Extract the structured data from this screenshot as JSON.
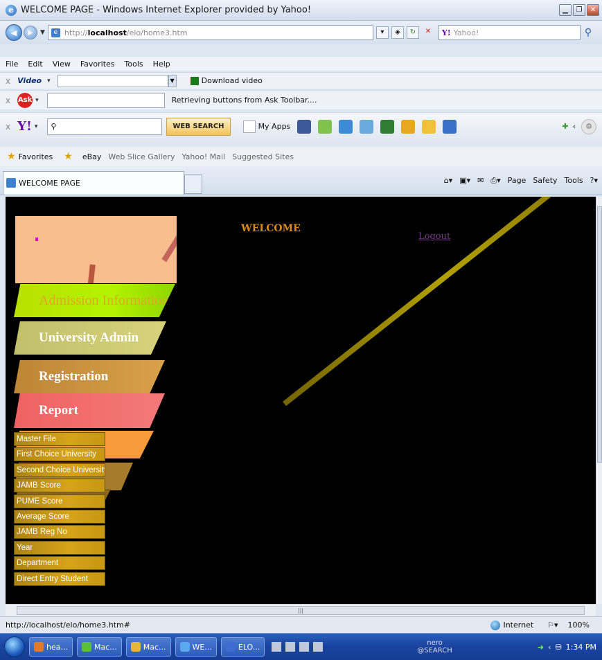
{
  "window": {
    "title": "WELCOME PAGE - Windows Internet Explorer provided by Yahoo!"
  },
  "address": {
    "url_prefix": "http://",
    "url_host": "localhost",
    "url_path": "/elo/home3.htm",
    "search_placeholder": "Yahoo!"
  },
  "menu": [
    "File",
    "Edit",
    "View",
    "Favorites",
    "Tools",
    "Help"
  ],
  "video_toolbar": {
    "label": "Video",
    "download": "Download video"
  },
  "ask_toolbar": {
    "status": "Retrieving buttons from Ask Toolbar...."
  },
  "yahoo_toolbar": {
    "search_button": "WEB SEARCH",
    "my_apps": "My Apps"
  },
  "favorites_bar": {
    "favorites": "Favorites",
    "items": [
      "eBay",
      "Web Slice Gallery",
      "Yahoo! Mail",
      "Suggested Sites"
    ]
  },
  "tab": {
    "title": "WELCOME PAGE"
  },
  "commands": [
    "Page",
    "Safety",
    "Tools"
  ],
  "page": {
    "welcome": "WELCOME",
    "logout": "Logout",
    "nav": [
      "Admission Information",
      "University Admin",
      "Registration",
      "Report"
    ],
    "report_items": [
      "Master File",
      "First Choice University",
      "Second Choice University",
      "JAMB Score",
      "PUME Score",
      "Average Score",
      "JAMB Reg No",
      "Year",
      "Department",
      "Direct Entry Student"
    ],
    "colors": {
      "background": "#000000",
      "banner": "#f9be8d",
      "admission": "#b4f300",
      "university_admin": "#d0cd76",
      "registration": "#d29a44",
      "report": "#f06a6a",
      "submenu": "#d0a018",
      "welcome_text": "#d88a1a"
    }
  },
  "status": {
    "url": "http://localhost/elo/home3.htm#",
    "zone": "Internet",
    "zoom": "100%"
  },
  "taskbar": {
    "tasks": [
      "hea...",
      "Mac...",
      "Mac...",
      "WE...",
      "ELO..."
    ],
    "nero": "nero",
    "nero_sub": "@SEARCH",
    "clock": "1:34 PM"
  }
}
